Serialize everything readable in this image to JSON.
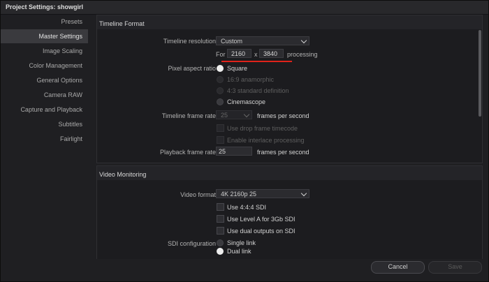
{
  "window": {
    "title": "Project Settings:  showgirl"
  },
  "sidebar": {
    "items": [
      {
        "label": "Presets"
      },
      {
        "label": "Master Settings"
      },
      {
        "label": "Image Scaling"
      },
      {
        "label": "Color Management"
      },
      {
        "label": "General Options"
      },
      {
        "label": "Camera RAW"
      },
      {
        "label": "Capture and Playback"
      },
      {
        "label": "Subtitles"
      },
      {
        "label": "Fairlight"
      }
    ],
    "active_item": "Master Settings"
  },
  "timeline_format": {
    "title": "Timeline Format",
    "resolution_label": "Timeline resolution",
    "resolution_value": "Custom",
    "for_label": "For",
    "width": "2160",
    "x_label": "x",
    "height": "3840",
    "processing_label": "processing",
    "pixel_aspect_label": "Pixel aspect ratio",
    "pixel_aspect_options": [
      {
        "label": "Square",
        "selected": true,
        "enabled": true
      },
      {
        "label": "16:9 anamorphic",
        "selected": false,
        "enabled": false
      },
      {
        "label": "4:3 standard definition",
        "selected": false,
        "enabled": false
      },
      {
        "label": "Cinemascope",
        "selected": false,
        "enabled": true
      }
    ],
    "frame_rate_label": "Timeline frame rate",
    "frame_rate_value": "25",
    "fps_label": "frames per second",
    "drop_frame_label": "Use drop frame timecode",
    "interlace_label": "Enable interlace processing",
    "playback_label": "Playback frame rate",
    "playback_value": "25",
    "playback_fps_label": "frames per second"
  },
  "video_monitoring": {
    "title": "Video Monitoring",
    "format_label": "Video format",
    "format_value": "4K 2160p 25",
    "checkboxes": [
      {
        "label": "Use 4:4:4 SDI"
      },
      {
        "label": "Use Level A for 3Gb SDI"
      },
      {
        "label": "Use dual outputs on SDI"
      }
    ],
    "sdi_label": "SDI configuration",
    "sdi_options": [
      {
        "label": "Single link",
        "selected": false
      },
      {
        "label": "Dual link",
        "selected": true
      }
    ]
  },
  "footer": {
    "cancel_label": "Cancel",
    "save_label": "Save"
  },
  "colors": {
    "accent_underline": "#e0231a",
    "background": "#1f1f22",
    "panel": "#1c1c1f"
  }
}
